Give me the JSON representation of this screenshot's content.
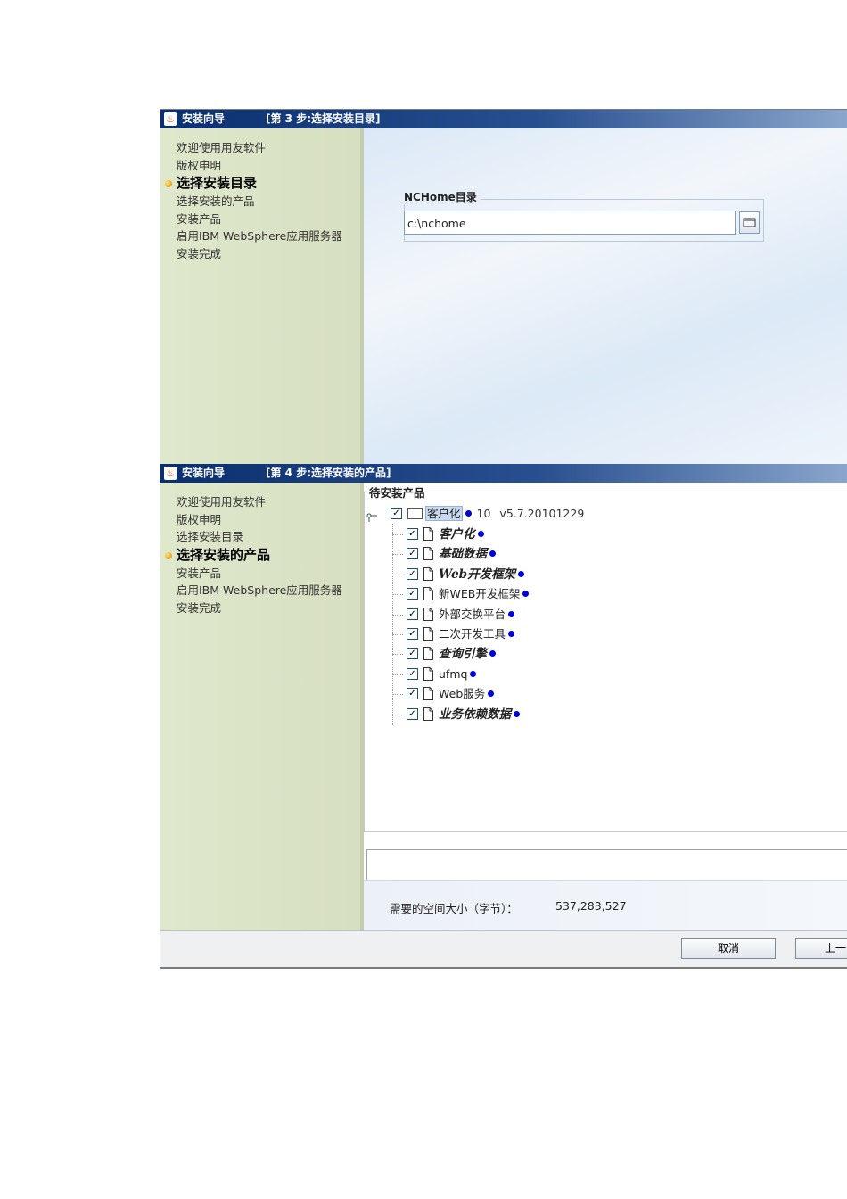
{
  "window1": {
    "app_title": "安装向导",
    "step_title": "[第 3 步:选择安装目录]",
    "steps": [
      "欢迎使用用友软件",
      "版权申明",
      "选择安装目录",
      "选择安装的产品",
      "安装产品",
      "启用IBM WebSphere应用服务器",
      "安装完成"
    ],
    "active_step": "选择安装目录",
    "nchome_group_title": "NCHome目录",
    "nchome_path": "c:\\nchome"
  },
  "window2": {
    "app_title": "安装向导",
    "step_title": "[第 4 步:选择安装的产品]",
    "steps": [
      "欢迎使用用友软件",
      "版权申明",
      "选择安装目录",
      "选择安装的产品",
      "安装产品",
      "启用IBM WebSphere应用服务器",
      "安装完成"
    ],
    "active_step": "选择安装的产品",
    "tree_title": "待安装产品",
    "tree_root": {
      "label": "客户化",
      "count": "10",
      "version": "v5.7.20101229"
    },
    "tree_items": [
      {
        "label": "客户化",
        "style": "bold-italic"
      },
      {
        "label": "基础数据",
        "style": "bold-italic"
      },
      {
        "label": "Web开发框架",
        "style": "bold-italic"
      },
      {
        "label": "新WEB开发框架",
        "style": "normal"
      },
      {
        "label": "外部交换平台",
        "style": "normal"
      },
      {
        "label": "二次开发工具",
        "style": "normal"
      },
      {
        "label": "查询引擎",
        "style": "bold-italic"
      },
      {
        "label": "ufmq",
        "style": "normal"
      },
      {
        "label": "Web服务",
        "style": "normal"
      },
      {
        "label": "业务依赖数据",
        "style": "bold-italic"
      }
    ],
    "space_label": "需要的空间大小（字节）：",
    "space_value": "537,283,527",
    "buttons": {
      "cancel": "取消",
      "prev": "上一"
    }
  },
  "colors": {
    "title_bar": "#0a2f6f",
    "sidebar": "#dfe8cc",
    "tree_dot": "#0000dd",
    "active_bullet": "#e0a000"
  }
}
